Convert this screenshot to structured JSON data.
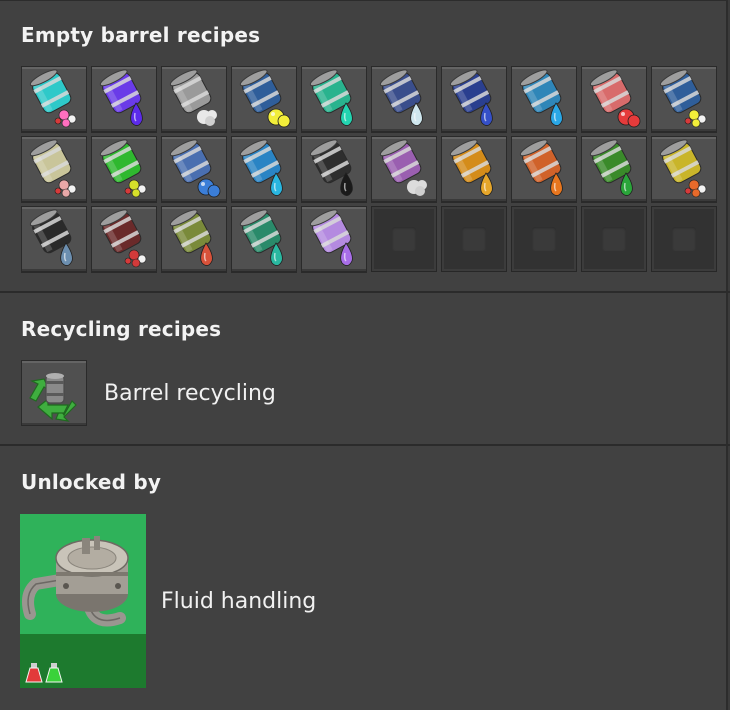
{
  "sections": {
    "empty_barrel": {
      "title": "Empty barrel recipes",
      "recipes": [
        {
          "name": "light-oil-barrel-a",
          "color": "#2ec9c9",
          "drop": "#ff6fbf",
          "type": "molecule"
        },
        {
          "name": "heavy-purple-barrel",
          "color": "#6a3be8",
          "drop": "#5c2bea",
          "type": "drop"
        },
        {
          "name": "steam-barrel",
          "color": "#9a9a9a",
          "drop": "#e8e8e8",
          "type": "cloud"
        },
        {
          "name": "sulfur-barrel",
          "color": "#2f5e9a",
          "drop": "#f2ee3a",
          "type": "blob"
        },
        {
          "name": "teal-fluid-barrel",
          "color": "#29b38e",
          "drop": "#23d4b0",
          "type": "drop"
        },
        {
          "name": "water-crystal-barrel",
          "color": "#3a4e8c",
          "drop": "#cfe7ef",
          "type": "drop"
        },
        {
          "name": "deep-blue-barrel",
          "color": "#2a3f8f",
          "drop": "#3550c8",
          "type": "drop"
        },
        {
          "name": "water-barrel",
          "color": "#2f86b8",
          "drop": "#2aa7e6",
          "type": "drop"
        },
        {
          "name": "red-gas-barrel",
          "color": "#d86b6b",
          "drop": "#e53b3b",
          "type": "blob"
        },
        {
          "name": "mixed-gas-barrel",
          "color": "#2f5e9a",
          "drop": "#f2ee3a",
          "type": "molecule"
        },
        {
          "name": "cream-barrel",
          "color": "#c9c59a",
          "drop": "#e9a8a8",
          "type": "molecule"
        },
        {
          "name": "green-molecule-barrel",
          "color": "#2fb82f",
          "drop": "#d6e02a",
          "type": "molecule"
        },
        {
          "name": "blue-molecule-barrel",
          "color": "#4a6fb0",
          "drop": "#3b7ed8",
          "type": "blob"
        },
        {
          "name": "cyan-fluid-barrel",
          "color": "#2a84c4",
          "drop": "#29b6e0",
          "type": "drop"
        },
        {
          "name": "crude-oil-barrel",
          "color": "#2e2e2e",
          "drop": "#1a1a1a",
          "type": "drop"
        },
        {
          "name": "violet-gas-barrel",
          "color": "#9a5fb0",
          "drop": "#dcdcdc",
          "type": "cloud"
        },
        {
          "name": "amber-barrel",
          "color": "#d48c1a",
          "drop": "#e6a62a",
          "type": "drop"
        },
        {
          "name": "orange-barrel",
          "color": "#d0622a",
          "drop": "#e8761e",
          "type": "drop"
        },
        {
          "name": "green-drop-barrel",
          "color": "#3a8a2a",
          "drop": "#2aa53a",
          "type": "drop"
        },
        {
          "name": "yellow-molecule-barrel",
          "color": "#c9b52a",
          "drop": "#e86a2a",
          "type": "molecule"
        },
        {
          "name": "dark-crystal-barrel",
          "color": "#2a2a2a",
          "drop": "#6c8fb0",
          "type": "drop"
        },
        {
          "name": "red-molecule-barrel",
          "color": "#6a2a2a",
          "drop": "#d23a3a",
          "type": "molecule"
        },
        {
          "name": "olive-barrel",
          "color": "#7a8a3a",
          "drop": "#d8523a",
          "type": "drop"
        },
        {
          "name": "sea-green-barrel",
          "color": "#2a8a6a",
          "drop": "#2ab8a0",
          "type": "drop"
        },
        {
          "name": "lavender-barrel",
          "color": "#b48ae0",
          "drop": "#a86ee8",
          "type": "drop"
        }
      ],
      "empty_slots": 5
    },
    "recycling": {
      "title": "Recycling recipes",
      "items": [
        {
          "label": "Barrel recycling",
          "icon": "barrel-recycling-icon"
        }
      ]
    },
    "unlocked_by": {
      "title": "Unlocked by",
      "technology": {
        "label": "Fluid handling",
        "icon": "storage-tank-icon",
        "card_color": "#2fb25a",
        "science_packs": [
          "automation-science-pack-icon",
          "logistic-science-pack-icon"
        ]
      }
    }
  }
}
